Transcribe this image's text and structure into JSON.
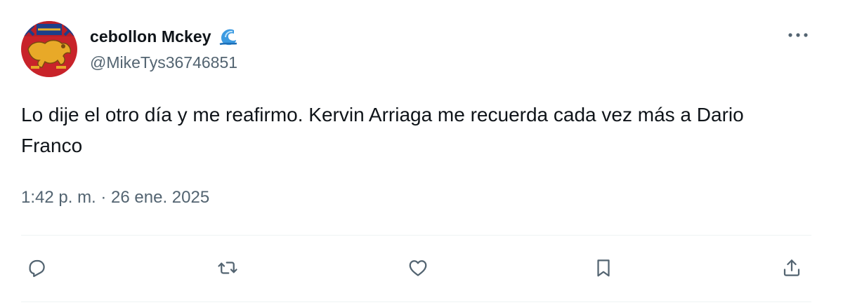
{
  "author": {
    "display_name": "cebollon Mckey",
    "handle": "@MikeTys36746851",
    "badge_icon": "wave-emoji-icon",
    "avatar_icon": "heraldic-lion-shield-icon"
  },
  "tweet": {
    "text": "Lo dije el otro día y me reafirmo. Kervin Arriaga me recuerda cada vez más a Dario Franco",
    "timestamp": "1:42 p. m. · 26 ene. 2025"
  },
  "menu": {
    "icon": "more-horizontal-icon"
  },
  "actions": [
    {
      "name": "reply",
      "icon": "reply-bubble-icon"
    },
    {
      "name": "retweet",
      "icon": "retweet-icon"
    },
    {
      "name": "like",
      "icon": "heart-icon"
    },
    {
      "name": "bookmark",
      "icon": "bookmark-icon"
    },
    {
      "name": "share",
      "icon": "share-icon"
    }
  ],
  "colors": {
    "text": "#0f1419",
    "secondary": "#536471",
    "divider": "#eff3f4",
    "icon": "#536471"
  }
}
